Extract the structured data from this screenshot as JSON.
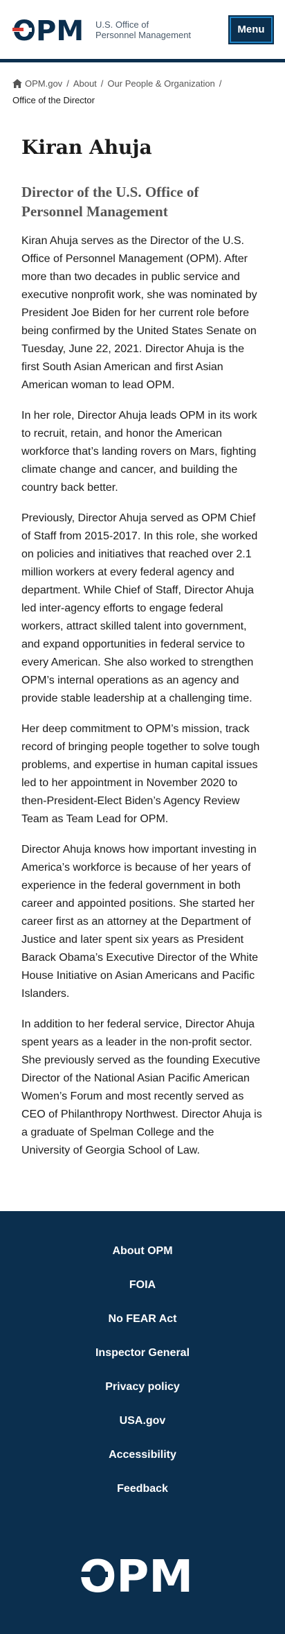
{
  "header": {
    "logo_text": "OPM",
    "agency_line1": "U.S. Office of",
    "agency_line2": "Personnel Management",
    "menu_label": "Menu"
  },
  "breadcrumb": {
    "items": [
      "OPM.gov",
      "About",
      "Our People & Organization"
    ],
    "current": "Office of the Director"
  },
  "main": {
    "title": "Kiran Ahuja",
    "subtitle": "Director of the U.S. Office of Personnel Management",
    "paragraphs": [
      "Kiran Ahuja serves as the Director of the U.S. Office of Personnel Management (OPM). After more than two decades in public service and executive nonprofit work, she was nominated by President Joe Biden for her current role before being confirmed by the United States Senate on Tuesday, June 22, 2021. Director Ahuja is the first South Asian American and first Asian American woman to lead OPM.",
      "In her role, Director Ahuja leads OPM in its work to recruit, retain, and honor the American workforce that’s landing rovers on Mars, fighting climate change and cancer, and building the country back better.",
      "Previously, Director Ahuja served as OPM Chief of Staff from 2015-2017. In this role, she worked on policies and initiatives that reached over 2.1 million workers at every federal agency and department. While Chief of Staff, Director Ahuja led inter-agency efforts to engage federal workers, attract skilled talent into government, and expand opportunities in federal service to every American. She also worked to strengthen OPM’s internal operations as an agency and provide stable leadership at a challenging time.",
      "Her deep commitment to OPM’s mission, track record of bringing people together to solve tough problems, and expertise in human capital issues led to her appointment in November 2020 to then-President-Elect Biden’s Agency Review Team as Team Lead for OPM.",
      "Director Ahuja knows how important investing in America’s workforce is because of her years of experience in the federal government in both career and appointed positions. She started her career first as an attorney at the Department of Justice and later spent six years as President Barack Obama’s Executive Director of the White House Initiative on Asian Americans and Pacific Islanders.",
      "In addition to her federal service, Director Ahuja spent years as a leader in the non-profit sector. She previously served as the founding Executive Director of the National Asian Pacific American Women’s Forum and most recently served as CEO of Philanthropy Northwest. Director Ahuja is a graduate of Spelman College and the University of Georgia School of Law."
    ]
  },
  "footer": {
    "links": [
      "About OPM",
      "FOIA",
      "No FEAR Act",
      "Inspector General",
      "Privacy policy",
      "USA.gov",
      "Accessibility",
      "Feedback"
    ],
    "logo_text": "OPM"
  },
  "colors": {
    "brand_navy": "#0b2f4e",
    "accent_red": "#d83933",
    "accent_blue": "#1e83c5"
  },
  "icons": {
    "home": "home-icon"
  }
}
